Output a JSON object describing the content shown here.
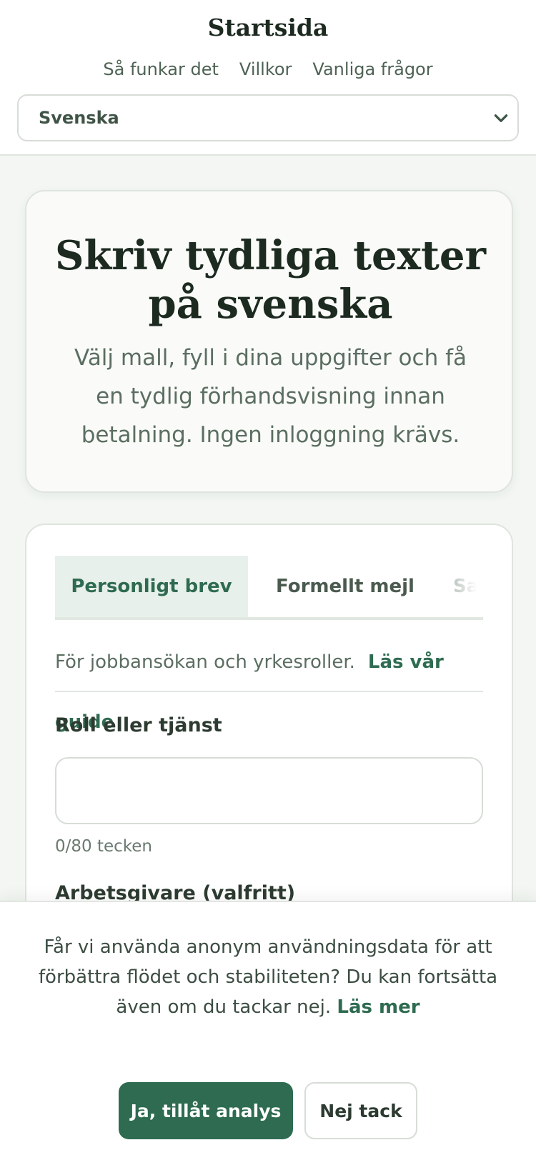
{
  "header": {
    "title": "Startsida",
    "nav": [
      "Så funkar det",
      "Villkor",
      "Vanliga frågor"
    ],
    "language": {
      "selected": "Svenska"
    }
  },
  "hero": {
    "heading": "Skriv tydliga texter på svenska",
    "subtitle": "Välj mall, fyll i dina uppgifter och få en tydlig förhandsvisning innan betalning. Ingen inloggning krävs."
  },
  "form": {
    "tabs": [
      {
        "label": "Personligt brev",
        "active": true
      },
      {
        "label": "Formellt mejl",
        "active": false
      },
      {
        "label": "Sa",
        "active": false
      }
    ],
    "description": "För jobbansökan och yrkesroller.",
    "guide_link": "Läs vår guide",
    "fields": [
      {
        "label": "Roll eller tjänst",
        "value": "",
        "counter": "0/80 tecken"
      },
      {
        "label": "Arbetsgivare (valfritt)"
      }
    ]
  },
  "consent": {
    "text": "Får vi använda anonym användningsdata för att förbättra flödet och stabiliteten? Du kan fortsätta även om du tackar nej.",
    "read_more": "Läs mer",
    "accept_label": "Ja, tillåt analys",
    "decline_label": "Nej tack"
  },
  "colors": {
    "accent": "#2e6b51",
    "page_background": "#f3f6f2",
    "heading_text": "#1c2a20"
  },
  "icons": {
    "language_chevron": "chevron-down-icon"
  }
}
